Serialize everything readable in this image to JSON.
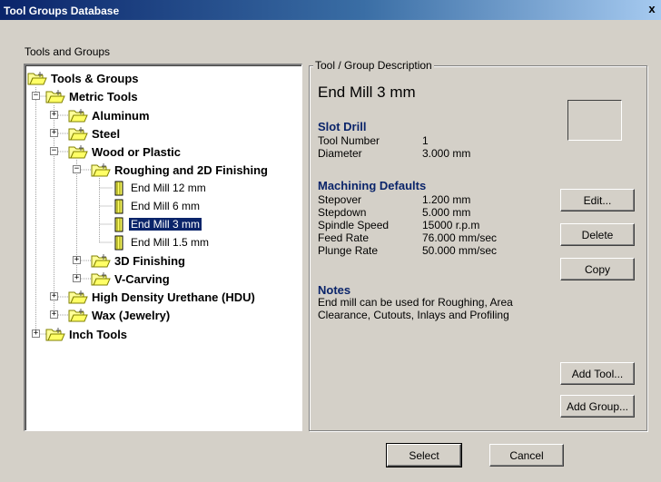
{
  "window": {
    "title": "Tool Groups Database",
    "close": "x"
  },
  "tree_label": "Tools and Groups",
  "tree": [
    {
      "label": "Tools & Groups",
      "bold": true
    },
    {
      "label": "Metric Tools",
      "bold": true,
      "toggle": "−"
    },
    {
      "label": "Aluminum",
      "bold": true,
      "toggle": "+"
    },
    {
      "label": "Steel",
      "bold": true,
      "toggle": "+"
    },
    {
      "label": "Wood or Plastic",
      "bold": true,
      "toggle": "−"
    },
    {
      "label": "Roughing and 2D Finishing",
      "bold": true,
      "toggle": "−"
    },
    {
      "label": "End Mill 12 mm"
    },
    {
      "label": "End Mill 6 mm"
    },
    {
      "label": "End Mill 3 mm",
      "selected": true
    },
    {
      "label": "End Mill 1.5 mm"
    },
    {
      "label": "3D Finishing",
      "bold": true,
      "toggle": "+"
    },
    {
      "label": "V-Carving",
      "bold": true,
      "toggle": "+"
    },
    {
      "label": "High Density Urethane (HDU)",
      "bold": true,
      "toggle": "+"
    },
    {
      "label": "Wax (Jewelry)",
      "bold": true,
      "toggle": "+"
    },
    {
      "label": "Inch Tools",
      "bold": true,
      "toggle": "+"
    }
  ],
  "description": {
    "group_title": "Tool / Group Description",
    "tool_name": "End Mill 3 mm",
    "tool_type": "Slot Drill",
    "tool_number_label": "Tool Number",
    "tool_number": "1",
    "diameter_label": "Diameter",
    "diameter": "3.000 mm",
    "defaults_heading": "Machining Defaults",
    "stepover_label": "Stepover",
    "stepover": "1.200 mm",
    "stepdown_label": "Stepdown",
    "stepdown": "5.000 mm",
    "spindle_label": "Spindle Speed",
    "spindle": "15000 r.p.m",
    "feed_label": "Feed Rate",
    "feed": "76.000 mm/sec",
    "plunge_label": "Plunge Rate",
    "plunge": "50.000 mm/sec",
    "notes_heading": "Notes",
    "notes": "End mill can be used for Roughing, Area Clearance, Cutouts, Inlays and Profiling"
  },
  "buttons": {
    "edit": "Edit...",
    "delete": "Delete",
    "copy": "Copy",
    "add_tool": "Add Tool...",
    "add_group": "Add Group...",
    "select": "Select",
    "cancel": "Cancel"
  },
  "colors": {
    "selection": "#0a246a",
    "heading": "#0a246a",
    "face": "#d4d0c8"
  },
  "icons": {
    "group": "folder-tools-icon",
    "tool": "end-mill-icon"
  }
}
